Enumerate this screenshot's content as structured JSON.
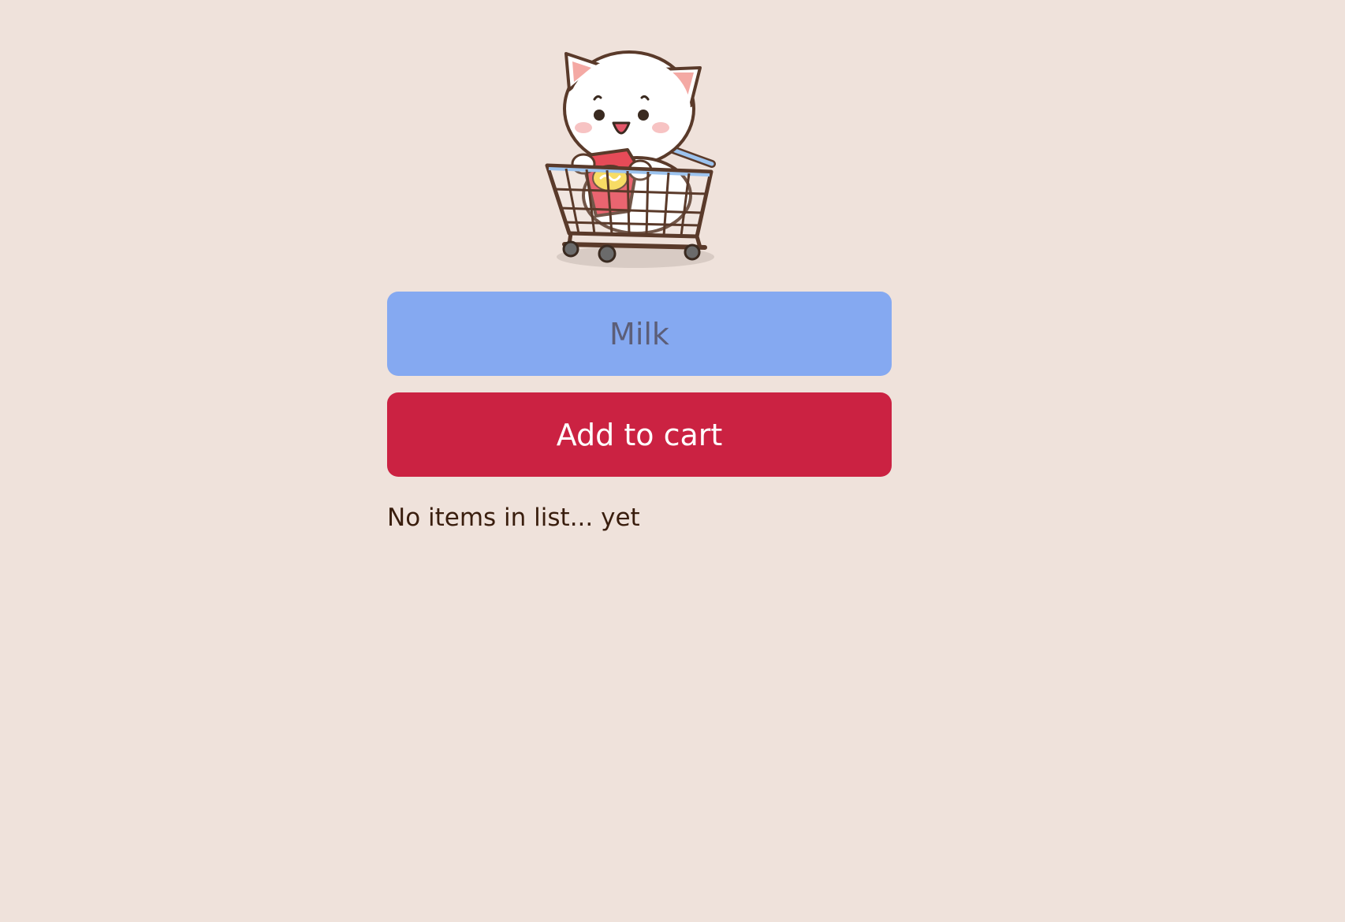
{
  "mascot": {
    "icon": "cat-in-shopping-cart-icon"
  },
  "form": {
    "input_placeholder": "Milk",
    "input_value": "",
    "add_button_label": "Add to cart"
  },
  "list": {
    "empty_message": "No items in list... yet"
  },
  "colors": {
    "background": "#EFE2DB",
    "input_background": "#85A9F1",
    "button_background": "#CB2242",
    "text": "#3A1E0E"
  }
}
